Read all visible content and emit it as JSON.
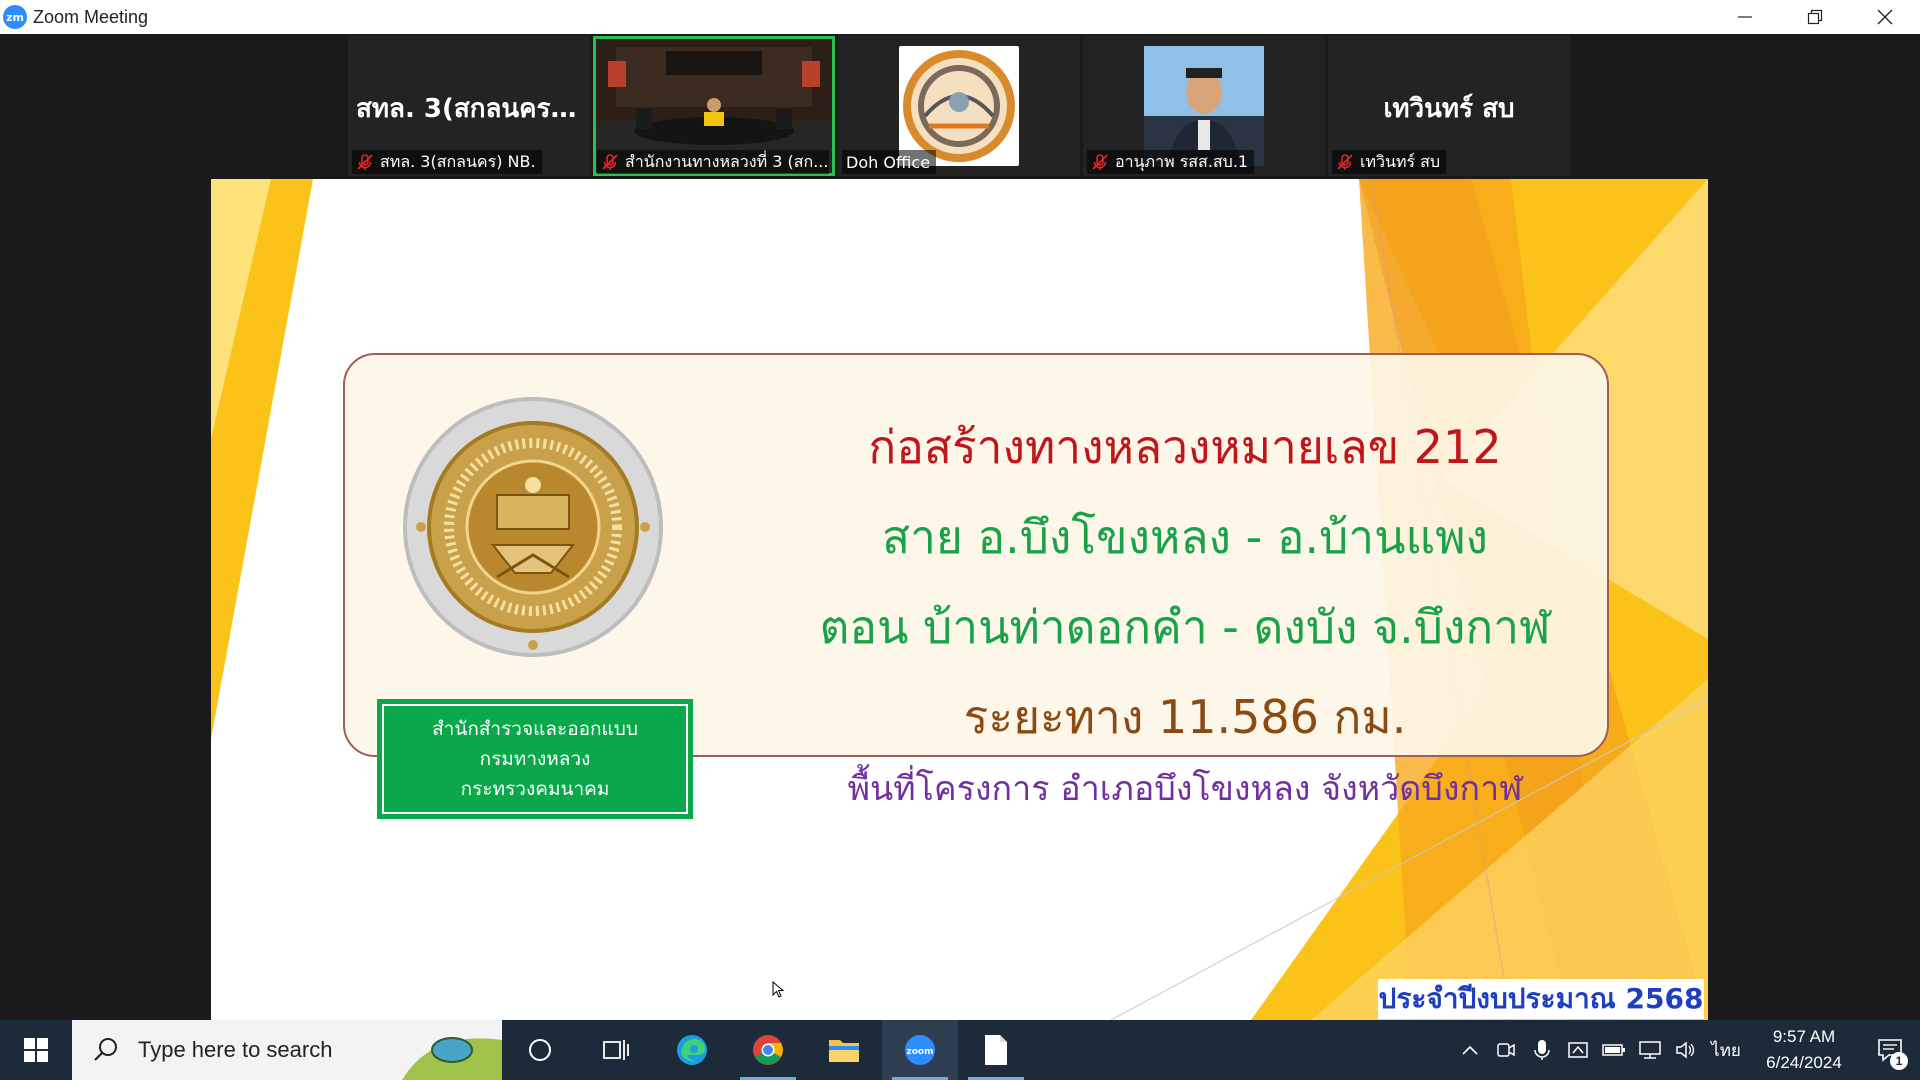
{
  "window": {
    "app_logo": "zm",
    "title": "Zoom Meeting",
    "controls": [
      "minimize-icon",
      "restore-icon",
      "close-icon"
    ]
  },
  "participants": [
    {
      "display_name": "สทล. 3(สกลนคร)...",
      "label": "สทล. 3(สกลนคร) NB.",
      "muted": true,
      "video": false
    },
    {
      "display_name": "",
      "label": "สำนักงานทางหลวงที่ 3 (สก...",
      "muted": true,
      "video": true,
      "active_speaker": true
    },
    {
      "display_name": "",
      "label": "Doh Office",
      "muted": false,
      "video": false,
      "avatar": "doh-logo"
    },
    {
      "display_name": "",
      "label": "อานุภาพ  รสส.สบ.1",
      "muted": true,
      "video": false,
      "avatar": "photo"
    },
    {
      "display_name": "เทวินทร์ สบ",
      "label": "เทวินทร์ สบ",
      "muted": true,
      "video": false
    }
  ],
  "slide": {
    "line1": "ก่อสร้างทางหลวงหมายเลข 212",
    "line2": "สาย อ.บึงโขงหลง - อ.บ้านแพง",
    "line3": "ตอน บ้านท่าดอกคำ - ดงบัง จ.บึงกาฬ",
    "line4": "ระยะทาง 11.586 กม.",
    "line5": "พื้นที่โครงการ อำเภอบึงโขงหลง จังหวัดบึงกาฬ",
    "org_lines": [
      "สำนักสำรวจและออกแบบ",
      "กรมทางหลวง",
      "กระทรวงคมนาคม"
    ],
    "budget_label": "ประจำปีงบประมาณ 2568",
    "colors": {
      "line1": "#c0161b",
      "line2": "#1aa24a",
      "line4": "#8a4a12",
      "line5": "#7030a0",
      "org_box": "#0aa84a",
      "accent": "#fbc21a"
    }
  },
  "taskbar": {
    "search_placeholder": "Type here to search",
    "apps": [
      "task-view-circle-icon",
      "task-view-icon",
      "edge-icon",
      "chrome-icon",
      "file-explorer-icon",
      "zoom-icon",
      "document-icon"
    ],
    "tray_icons": [
      "chevron-up-icon",
      "meet-now-icon",
      "microphone-icon",
      "network-icon",
      "battery-icon",
      "ethernet-icon",
      "volume-icon"
    ],
    "language": "ไทย",
    "time": "9:57 AM",
    "date": "6/24/2024",
    "notification_count": "1"
  }
}
